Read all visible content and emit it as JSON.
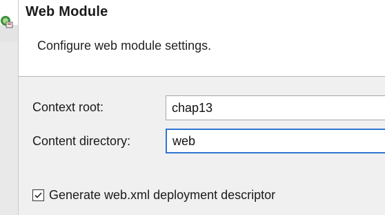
{
  "header": {
    "title": "Web Module",
    "description": "Configure web module settings."
  },
  "form": {
    "context_root_label": "Context root:",
    "context_root_value": "chap13",
    "content_directory_label": "Content directory:",
    "content_directory_value": "web",
    "generate_descriptor_label": "Generate web.xml deployment descriptor",
    "generate_descriptor_checked": true
  },
  "colors": {
    "focus_border": "#2f74d0",
    "banner_background": "#ffffff",
    "dialog_background": "#f0f0f0"
  },
  "icons": {
    "wizard": "web-module-wizard-icon",
    "checkbox": "checkmark-icon"
  }
}
